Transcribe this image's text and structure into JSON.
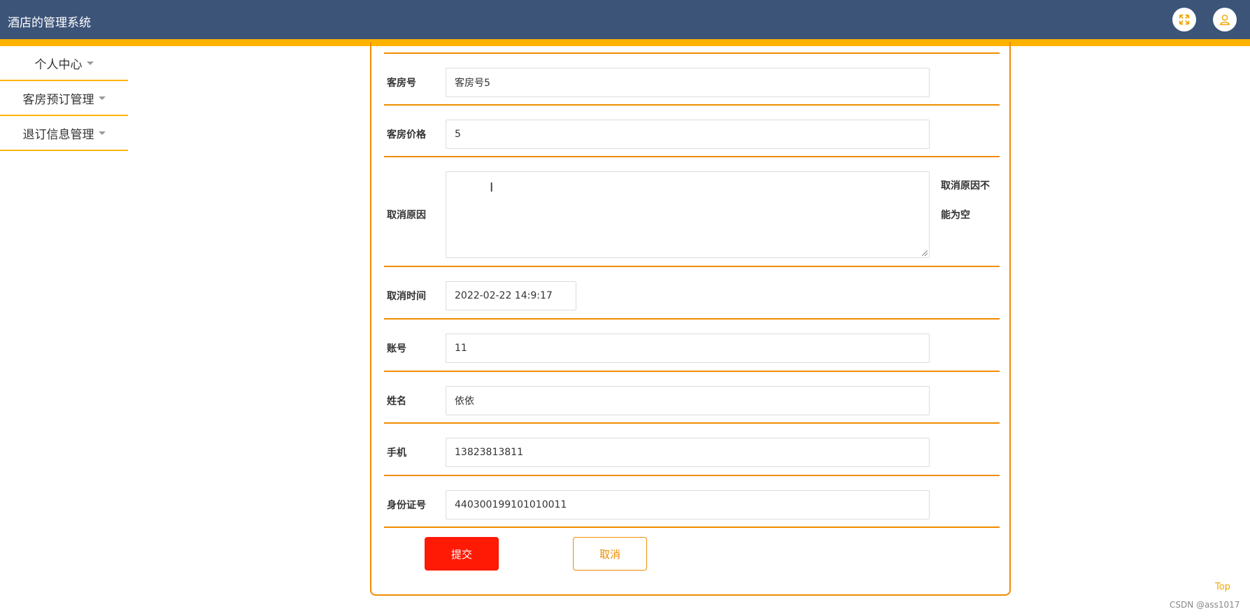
{
  "header": {
    "title": "酒店的管理系统",
    "icons": [
      "fullscreen-icon",
      "user-icon"
    ]
  },
  "sidebar": {
    "items": [
      {
        "label": "个人中心"
      },
      {
        "label": "客房预订管理"
      },
      {
        "label": "退订信息管理"
      }
    ]
  },
  "form": {
    "room_no": {
      "label": "客房号",
      "value": "客房号5"
    },
    "room_price": {
      "label": "客房价格",
      "value": "5"
    },
    "cancel_reason": {
      "label": "取消原因",
      "value": "",
      "error_line1": "取消原因不",
      "error_line2": "能为空"
    },
    "cancel_time": {
      "label": "取消时间",
      "value": "2022-02-22 14:9:17"
    },
    "account": {
      "label": "账号",
      "value": "11"
    },
    "name": {
      "label": "姓名",
      "value": "依依"
    },
    "phone": {
      "label": "手机",
      "value": "13823813811"
    },
    "id_card": {
      "label": "身份证号",
      "value": "440300199101010011"
    },
    "submit_label": "提交",
    "cancel_label": "取消"
  },
  "footer": {
    "top_label": "Top",
    "watermark": "CSDN @ass1017"
  },
  "colors": {
    "header_bg": "#3d5479",
    "accent": "#ffb300",
    "border": "#f08c00",
    "submit_bg": "#ff1a05"
  }
}
